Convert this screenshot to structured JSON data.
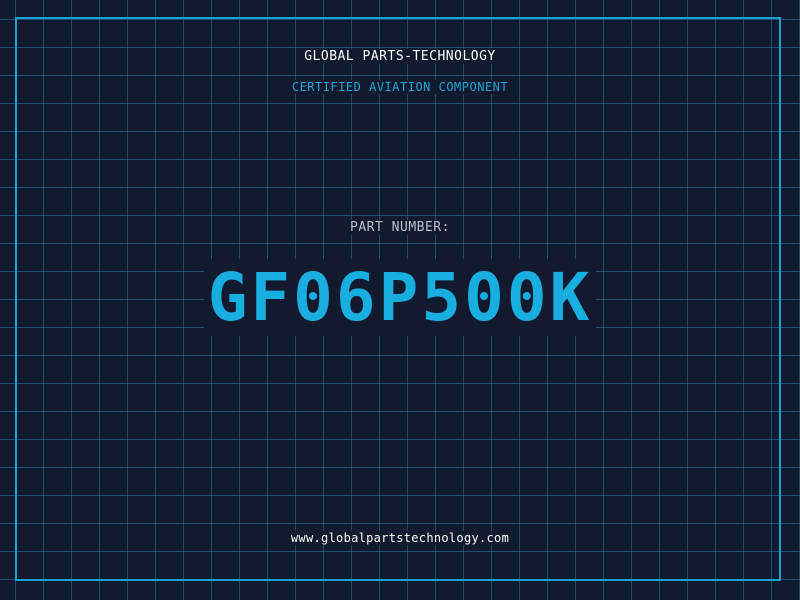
{
  "company": "GLOBAL PARTS-TECHNOLOGY",
  "subtitle": "CERTIFIED AVIATION COMPONENT",
  "part_label": "PART NUMBER:",
  "part_number": "GF06P500K",
  "website": "www.globalpartstechnology.com",
  "colors": {
    "background": "#111a2e",
    "grid": "#287896",
    "frame": "#1aa3cf",
    "accent": "#19aee0"
  }
}
